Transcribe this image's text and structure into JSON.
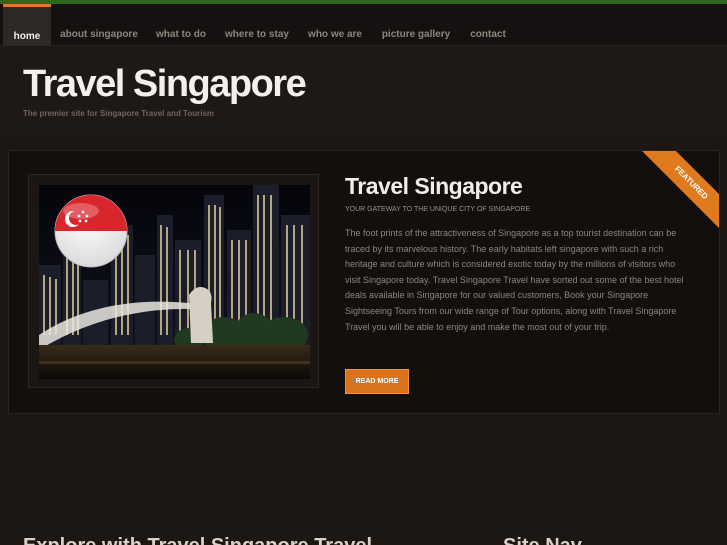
{
  "nav": {
    "items": [
      {
        "label": "home"
      },
      {
        "label": "about singapore"
      },
      {
        "label": "what to do"
      },
      {
        "label": "where to stay"
      },
      {
        "label": "who we are"
      },
      {
        "label": "picture gallery"
      },
      {
        "label": "contact"
      }
    ],
    "active": "home"
  },
  "site": {
    "title": "Travel Singapore",
    "tagline": "The premier site for Singapore Travel and Tourism"
  },
  "feature": {
    "badge": "FEATURED",
    "title": "Travel Singapore",
    "subtitle": "YOUR GATEWAY TO THE UNIQUE CITY OF SINGAPORE",
    "body": "The foot prints of the attractiveness of Singapore as a top tourist destination can be traced by its marvelous history. The early habitats left singapore with such a rich heritage and culture which is considered exotic today by the millions of visitors who visit Singapore today. Travel Singapore Travel have sorted out some of the best hotel deals available in Singapore for our valued customers, Book your Singapore Sightseeing Tours from our wide range of Tour options, along with Travel Singapore Travel you will be able to enjoy and make the most out of your trip.",
    "button": "READ MORE"
  },
  "sections": {
    "explore": "Explore with Travel Singapore Travel",
    "site_nav": "Site Nav"
  },
  "colors": {
    "accent": "#e07a1f",
    "top_bar": "#2b6a1c",
    "background": "#1d1714"
  }
}
